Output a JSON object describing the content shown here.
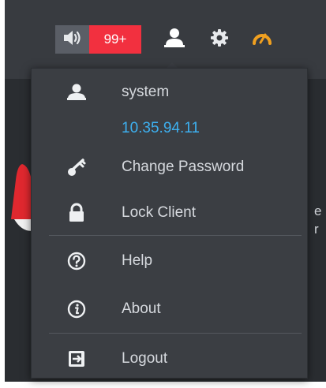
{
  "toolbar": {
    "notification_count": "99+",
    "icons": {
      "speaker": "speaker-icon",
      "user": "user-icon",
      "settings": "gear-icon",
      "performance": "gauge-icon"
    },
    "colors": {
      "badge": "#f2303f",
      "gauge": "#f0a020"
    }
  },
  "user_menu": {
    "username": "system",
    "ip_address": "10.35.94.11",
    "items": [
      {
        "label": "Change Password",
        "icon": "key-icon"
      },
      {
        "label": "Lock Client",
        "icon": "lock-icon"
      },
      {
        "label": "Help",
        "icon": "help-circle-icon"
      },
      {
        "label": "About",
        "icon": "info-circle-icon"
      },
      {
        "label": "Logout",
        "icon": "logout-icon"
      }
    ],
    "colors": {
      "ip": "#3db0f0",
      "text": "#d6d9de",
      "background": "#3b3e43"
    }
  },
  "background_fragments": {
    "line1": "e",
    "line2": "r"
  }
}
